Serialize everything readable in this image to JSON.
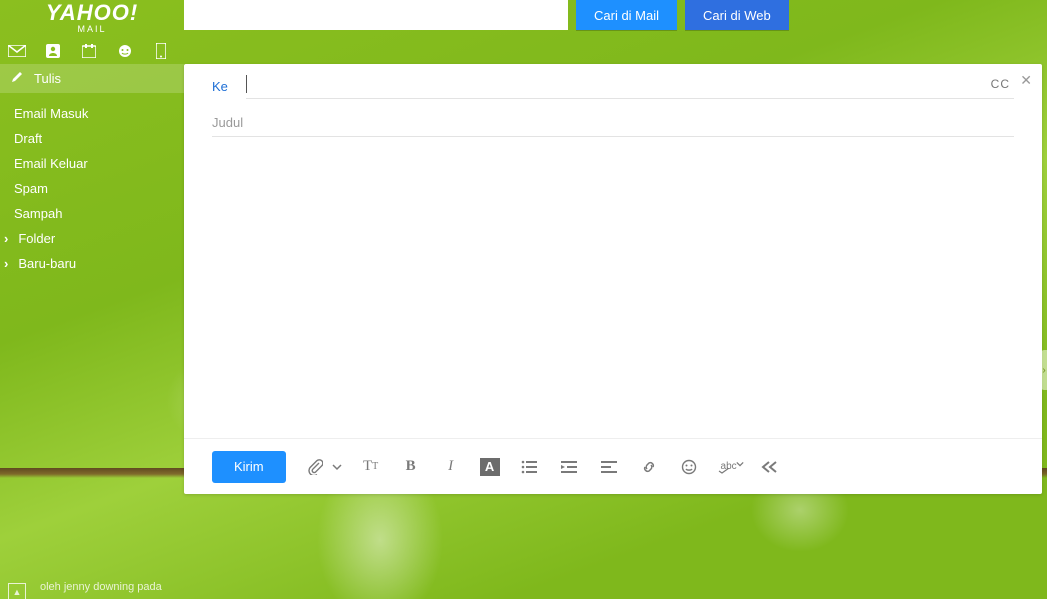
{
  "logo": {
    "main": "YAHOO!",
    "sub": "MAIL"
  },
  "search": {
    "value": "",
    "mail_button": "Cari di Mail",
    "web_button": "Cari di Web"
  },
  "compose_button": "Tulis",
  "folders": [
    {
      "label": "Email Masuk",
      "name": "inbox"
    },
    {
      "label": "Draft",
      "name": "drafts"
    },
    {
      "label": "Email Keluar",
      "name": "sent"
    },
    {
      "label": "Spam",
      "name": "spam"
    },
    {
      "label": "Sampah",
      "name": "trash"
    }
  ],
  "expandables": [
    {
      "label": "Folder",
      "name": "folders"
    },
    {
      "label": "Baru-baru",
      "name": "recent"
    }
  ],
  "compose": {
    "to_label": "Ke",
    "cc_label": "CC",
    "subject_placeholder": "Judul",
    "to_value": "",
    "subject_value": "",
    "body_value": "",
    "send_button": "Kirim",
    "spellcheck_label": "abc"
  },
  "credit": "oleh jenny downing pada"
}
